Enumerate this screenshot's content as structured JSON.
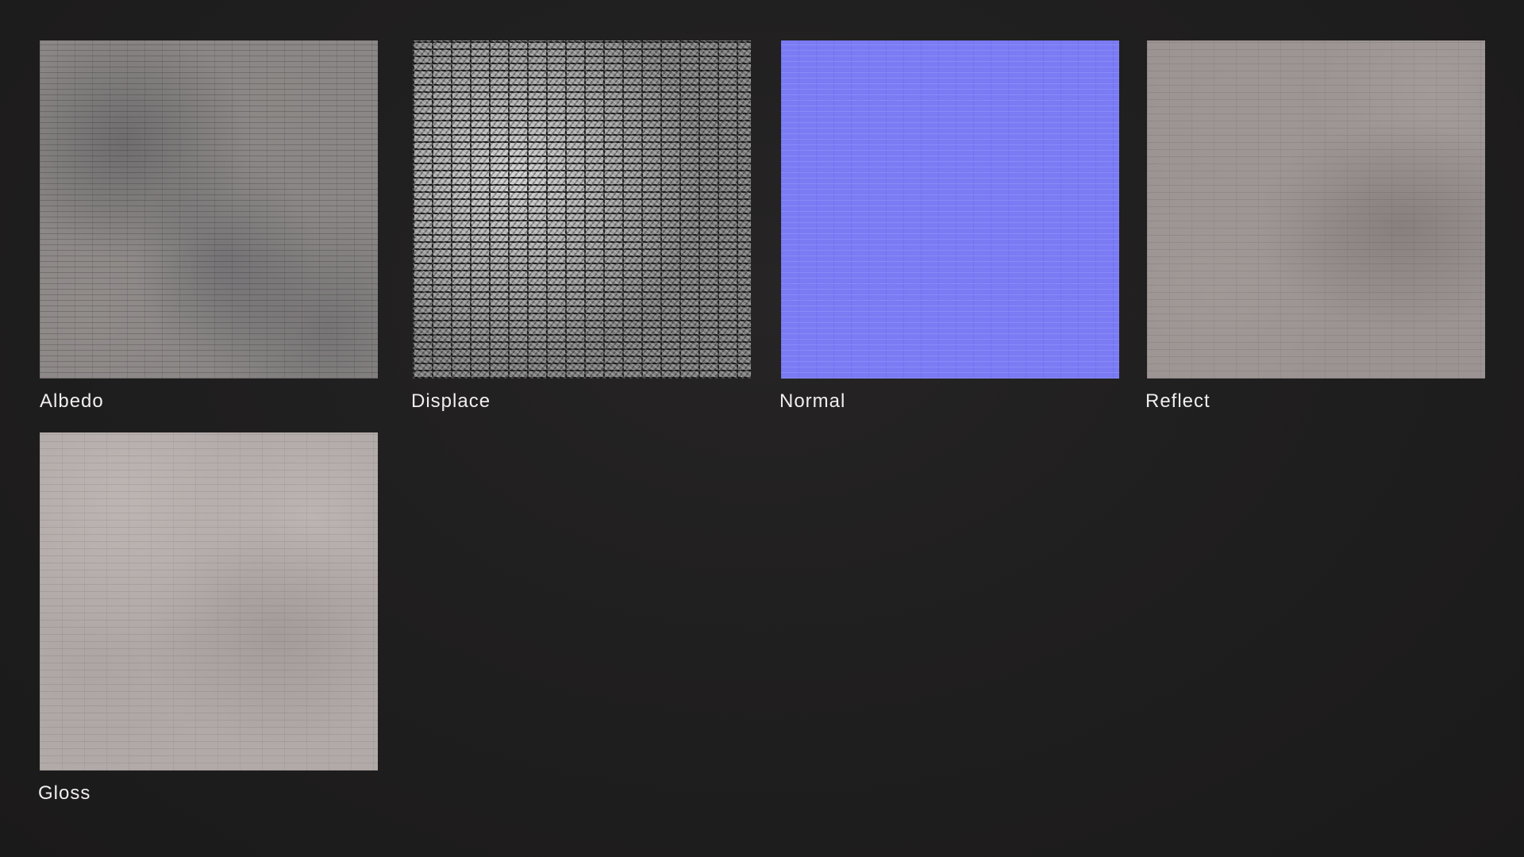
{
  "maps": [
    {
      "label": "Albedo",
      "icon": "brick-texture-albedo",
      "color": "#8b8786"
    },
    {
      "label": "Displace",
      "icon": "brick-texture-displace",
      "color": "#8a8a8a"
    },
    {
      "label": "Normal",
      "icon": "brick-texture-normal",
      "color": "#7b7bf3"
    },
    {
      "label": "Reflect",
      "icon": "brick-texture-reflect",
      "color": "#9c9492"
    },
    {
      "label": "Gloss",
      "icon": "brick-texture-gloss",
      "color": "#b2aaa8"
    }
  ],
  "colors": {
    "background": "#211f1f",
    "caption": "#f0eeee"
  }
}
